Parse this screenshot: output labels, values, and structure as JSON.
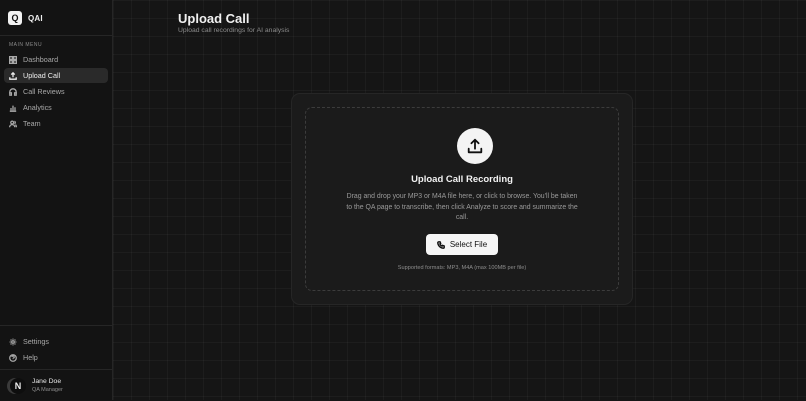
{
  "app": {
    "name": "QAI",
    "logo_letter": "Q"
  },
  "sidebar": {
    "section_label": "MAIN MENU",
    "items": [
      {
        "label": "Dashboard",
        "icon": "grid-icon",
        "active": false
      },
      {
        "label": "Upload Call",
        "icon": "upload-icon",
        "active": true
      },
      {
        "label": "Call Reviews",
        "icon": "headphones-icon",
        "active": false
      },
      {
        "label": "Analytics",
        "icon": "bar-chart-icon",
        "active": false
      },
      {
        "label": "Team",
        "icon": "users-icon",
        "active": false
      }
    ],
    "bottom_items": [
      {
        "label": "Settings",
        "icon": "gear-icon"
      },
      {
        "label": "Help",
        "icon": "help-icon"
      }
    ],
    "user": {
      "initial": "N",
      "name": "Jane Doe",
      "role": "QA Manager"
    }
  },
  "page": {
    "title": "Upload Call",
    "subtitle": "Upload call recordings for AI analysis"
  },
  "upload": {
    "heading": "Upload Call Recording",
    "description": "Drag and drop your MP3 or M4A file here, or click to browse. You'll be taken to the QA page to transcribe, then click Analyze to score and summarize the call.",
    "button_label": "Select File",
    "formats_note": "Supported formats: MP3, M4A (max 100MB per file)"
  },
  "colors": {
    "background": "#151515",
    "sidebar": "#131313",
    "accent": "#f4f4f4",
    "active_item": "#2a2a2a"
  }
}
